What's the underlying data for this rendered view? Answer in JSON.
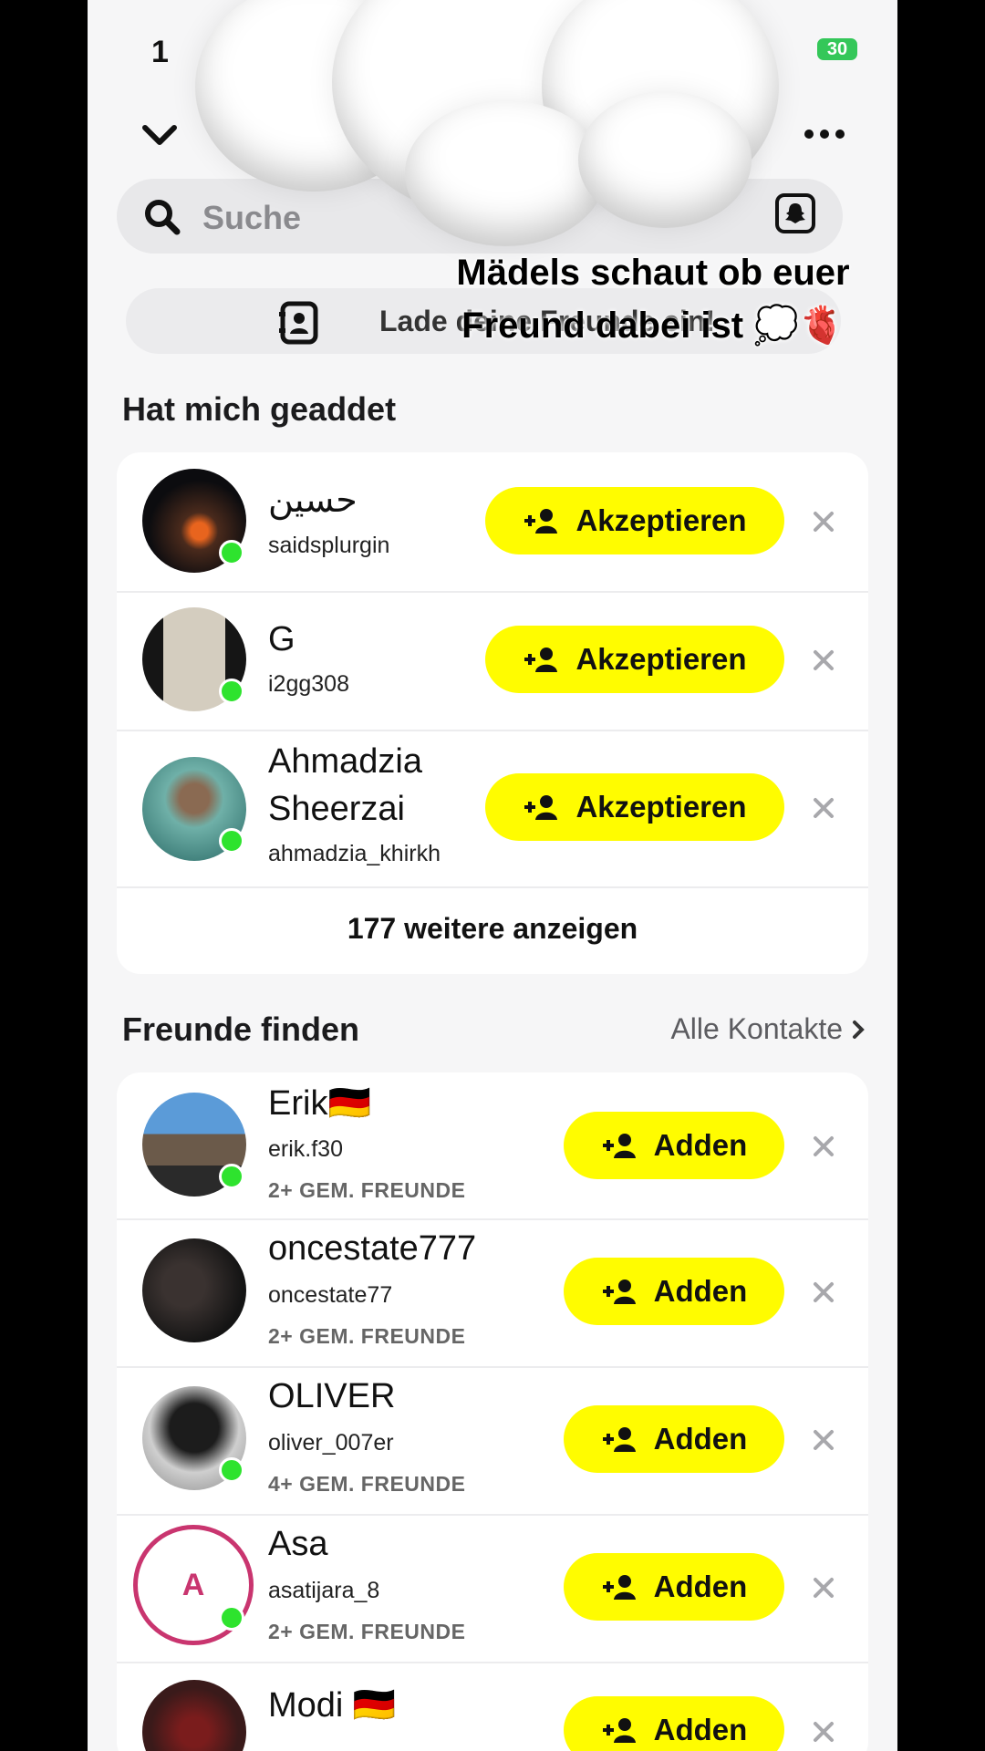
{
  "status": {
    "time": "1",
    "battery": "30"
  },
  "search": {
    "placeholder": "Suche"
  },
  "upload": {
    "label": "Lade deine Freunde ein!"
  },
  "overlay_caption": [
    "Mädels schaut ob euer",
    "Freund dabei ist 💭🫀"
  ],
  "added_me": {
    "title": "Hat mich geaddet",
    "accept_label": "Akzeptieren",
    "items": [
      {
        "name": "حسين",
        "handle": "saidsplurgin"
      },
      {
        "name": "G",
        "handle": "i2gg308"
      },
      {
        "name_line1": "Ahmadzia",
        "name_line2": "Sheerzai",
        "handle": "ahmadzia_khirkh"
      }
    ],
    "show_more": "177 weitere anzeigen"
  },
  "find_friends": {
    "title": "Freunde finden",
    "all_contacts": "Alle Kontakte",
    "add_label": "Adden",
    "items": [
      {
        "name": "Erik🇩🇪",
        "handle": "erik.f30",
        "mutual": "2+ GEM. FREUNDE"
      },
      {
        "name": "oncestate777",
        "handle": "oncestate77",
        "mutual": "2+ GEM. FREUNDE"
      },
      {
        "name": "OLIVER",
        "handle": "oliver_007er",
        "mutual": "4+ GEM. FREUNDE"
      },
      {
        "name": "Asa",
        "handle": "asatijara_8",
        "mutual": "2+ GEM. FREUNDE",
        "initial": "A"
      },
      {
        "name": "Modi 🇩🇪",
        "handle": ""
      }
    ]
  },
  "colors": {
    "accent": "#fffc00",
    "online": "#2ee32e",
    "background": "#f6f6f7"
  }
}
